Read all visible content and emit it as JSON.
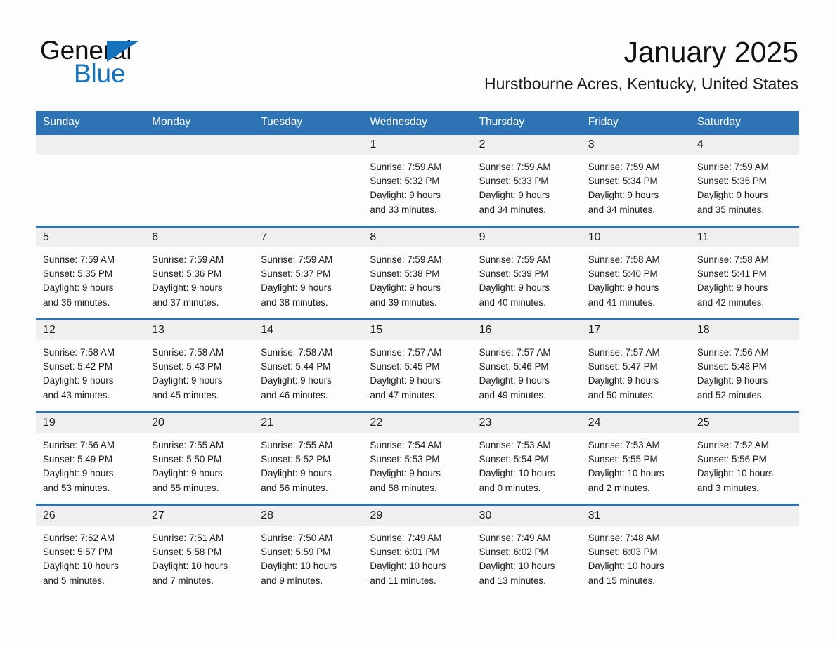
{
  "brand": {
    "name_part1": "General",
    "name_part2": "Blue",
    "accent_color": "#1573bd"
  },
  "header": {
    "month_title": "January 2025",
    "location": "Hurstbourne Acres, Kentucky, United States",
    "header_bar_color": "#2e74b5",
    "day_band_color": "#efefef"
  },
  "weekdays": [
    "Sunday",
    "Monday",
    "Tuesday",
    "Wednesday",
    "Thursday",
    "Friday",
    "Saturday"
  ],
  "weeks": [
    [
      {
        "day": "",
        "empty": true
      },
      {
        "day": "",
        "empty": true
      },
      {
        "day": "",
        "empty": true
      },
      {
        "day": "1",
        "sunrise": "Sunrise: 7:59 AM",
        "sunset": "Sunset: 5:32 PM",
        "daylight_1": "Daylight: 9 hours",
        "daylight_2": "and 33 minutes."
      },
      {
        "day": "2",
        "sunrise": "Sunrise: 7:59 AM",
        "sunset": "Sunset: 5:33 PM",
        "daylight_1": "Daylight: 9 hours",
        "daylight_2": "and 34 minutes."
      },
      {
        "day": "3",
        "sunrise": "Sunrise: 7:59 AM",
        "sunset": "Sunset: 5:34 PM",
        "daylight_1": "Daylight: 9 hours",
        "daylight_2": "and 34 minutes."
      },
      {
        "day": "4",
        "sunrise": "Sunrise: 7:59 AM",
        "sunset": "Sunset: 5:35 PM",
        "daylight_1": "Daylight: 9 hours",
        "daylight_2": "and 35 minutes."
      }
    ],
    [
      {
        "day": "5",
        "sunrise": "Sunrise: 7:59 AM",
        "sunset": "Sunset: 5:35 PM",
        "daylight_1": "Daylight: 9 hours",
        "daylight_2": "and 36 minutes."
      },
      {
        "day": "6",
        "sunrise": "Sunrise: 7:59 AM",
        "sunset": "Sunset: 5:36 PM",
        "daylight_1": "Daylight: 9 hours",
        "daylight_2": "and 37 minutes."
      },
      {
        "day": "7",
        "sunrise": "Sunrise: 7:59 AM",
        "sunset": "Sunset: 5:37 PM",
        "daylight_1": "Daylight: 9 hours",
        "daylight_2": "and 38 minutes."
      },
      {
        "day": "8",
        "sunrise": "Sunrise: 7:59 AM",
        "sunset": "Sunset: 5:38 PM",
        "daylight_1": "Daylight: 9 hours",
        "daylight_2": "and 39 minutes."
      },
      {
        "day": "9",
        "sunrise": "Sunrise: 7:59 AM",
        "sunset": "Sunset: 5:39 PM",
        "daylight_1": "Daylight: 9 hours",
        "daylight_2": "and 40 minutes."
      },
      {
        "day": "10",
        "sunrise": "Sunrise: 7:58 AM",
        "sunset": "Sunset: 5:40 PM",
        "daylight_1": "Daylight: 9 hours",
        "daylight_2": "and 41 minutes."
      },
      {
        "day": "11",
        "sunrise": "Sunrise: 7:58 AM",
        "sunset": "Sunset: 5:41 PM",
        "daylight_1": "Daylight: 9 hours",
        "daylight_2": "and 42 minutes."
      }
    ],
    [
      {
        "day": "12",
        "sunrise": "Sunrise: 7:58 AM",
        "sunset": "Sunset: 5:42 PM",
        "daylight_1": "Daylight: 9 hours",
        "daylight_2": "and 43 minutes."
      },
      {
        "day": "13",
        "sunrise": "Sunrise: 7:58 AM",
        "sunset": "Sunset: 5:43 PM",
        "daylight_1": "Daylight: 9 hours",
        "daylight_2": "and 45 minutes."
      },
      {
        "day": "14",
        "sunrise": "Sunrise: 7:58 AM",
        "sunset": "Sunset: 5:44 PM",
        "daylight_1": "Daylight: 9 hours",
        "daylight_2": "and 46 minutes."
      },
      {
        "day": "15",
        "sunrise": "Sunrise: 7:57 AM",
        "sunset": "Sunset: 5:45 PM",
        "daylight_1": "Daylight: 9 hours",
        "daylight_2": "and 47 minutes."
      },
      {
        "day": "16",
        "sunrise": "Sunrise: 7:57 AM",
        "sunset": "Sunset: 5:46 PM",
        "daylight_1": "Daylight: 9 hours",
        "daylight_2": "and 49 minutes."
      },
      {
        "day": "17",
        "sunrise": "Sunrise: 7:57 AM",
        "sunset": "Sunset: 5:47 PM",
        "daylight_1": "Daylight: 9 hours",
        "daylight_2": "and 50 minutes."
      },
      {
        "day": "18",
        "sunrise": "Sunrise: 7:56 AM",
        "sunset": "Sunset: 5:48 PM",
        "daylight_1": "Daylight: 9 hours",
        "daylight_2": "and 52 minutes."
      }
    ],
    [
      {
        "day": "19",
        "sunrise": "Sunrise: 7:56 AM",
        "sunset": "Sunset: 5:49 PM",
        "daylight_1": "Daylight: 9 hours",
        "daylight_2": "and 53 minutes."
      },
      {
        "day": "20",
        "sunrise": "Sunrise: 7:55 AM",
        "sunset": "Sunset: 5:50 PM",
        "daylight_1": "Daylight: 9 hours",
        "daylight_2": "and 55 minutes."
      },
      {
        "day": "21",
        "sunrise": "Sunrise: 7:55 AM",
        "sunset": "Sunset: 5:52 PM",
        "daylight_1": "Daylight: 9 hours",
        "daylight_2": "and 56 minutes."
      },
      {
        "day": "22",
        "sunrise": "Sunrise: 7:54 AM",
        "sunset": "Sunset: 5:53 PM",
        "daylight_1": "Daylight: 9 hours",
        "daylight_2": "and 58 minutes."
      },
      {
        "day": "23",
        "sunrise": "Sunrise: 7:53 AM",
        "sunset": "Sunset: 5:54 PM",
        "daylight_1": "Daylight: 10 hours",
        "daylight_2": "and 0 minutes."
      },
      {
        "day": "24",
        "sunrise": "Sunrise: 7:53 AM",
        "sunset": "Sunset: 5:55 PM",
        "daylight_1": "Daylight: 10 hours",
        "daylight_2": "and 2 minutes."
      },
      {
        "day": "25",
        "sunrise": "Sunrise: 7:52 AM",
        "sunset": "Sunset: 5:56 PM",
        "daylight_1": "Daylight: 10 hours",
        "daylight_2": "and 3 minutes."
      }
    ],
    [
      {
        "day": "26",
        "sunrise": "Sunrise: 7:52 AM",
        "sunset": "Sunset: 5:57 PM",
        "daylight_1": "Daylight: 10 hours",
        "daylight_2": "and 5 minutes."
      },
      {
        "day": "27",
        "sunrise": "Sunrise: 7:51 AM",
        "sunset": "Sunset: 5:58 PM",
        "daylight_1": "Daylight: 10 hours",
        "daylight_2": "and 7 minutes."
      },
      {
        "day": "28",
        "sunrise": "Sunrise: 7:50 AM",
        "sunset": "Sunset: 5:59 PM",
        "daylight_1": "Daylight: 10 hours",
        "daylight_2": "and 9 minutes."
      },
      {
        "day": "29",
        "sunrise": "Sunrise: 7:49 AM",
        "sunset": "Sunset: 6:01 PM",
        "daylight_1": "Daylight: 10 hours",
        "daylight_2": "and 11 minutes."
      },
      {
        "day": "30",
        "sunrise": "Sunrise: 7:49 AM",
        "sunset": "Sunset: 6:02 PM",
        "daylight_1": "Daylight: 10 hours",
        "daylight_2": "and 13 minutes."
      },
      {
        "day": "31",
        "sunrise": "Sunrise: 7:48 AM",
        "sunset": "Sunset: 6:03 PM",
        "daylight_1": "Daylight: 10 hours",
        "daylight_2": "and 15 minutes."
      },
      {
        "day": "",
        "empty": true
      }
    ]
  ]
}
